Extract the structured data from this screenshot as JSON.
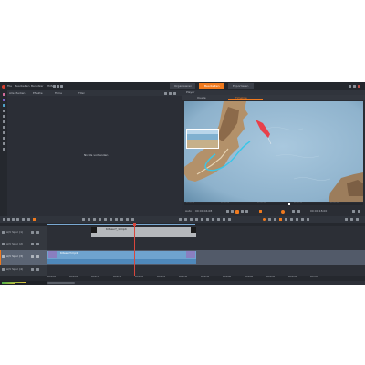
{
  "app": {
    "menu": [
      "File",
      "Bearbeiten",
      "Benutzer",
      "Hilfe"
    ],
    "mode_tabs": [
      {
        "label": "Organisieren",
        "active": false
      },
      {
        "label": "Bearbeiten",
        "active": true
      },
      {
        "label": "Exportieren",
        "active": false
      }
    ]
  },
  "library": {
    "toolbar": [
      "Alle Medien",
      "Effekte",
      "Filme",
      "Titel"
    ],
    "empty_text": "Nichts vorhanden"
  },
  "player": {
    "title": "Player",
    "tabs": [
      "Quelle",
      "Timeline"
    ],
    "active_tab": "Timeline",
    "zoom_label": "Auto",
    "timecode_left": "00:00:04.08",
    "timecode_right": "00:00:18.00",
    "ruler_ticks": [
      "00:00:00",
      "00:00:05",
      "00:00:10",
      "00:00:15",
      "00:00:20"
    ]
  },
  "timeline": {
    "tracks": [
      {
        "name": "A/V Spur (1)"
      },
      {
        "name": "A/V Spur (2)"
      },
      {
        "name": "A/V Spur (3)"
      },
      {
        "name": "A/V Spur (4)"
      }
    ],
    "clips": [
      {
        "label": "Kitesurf_1.mp4"
      },
      {
        "label": "Kitesurf.mp4"
      }
    ],
    "ruler_ticks": [
      "00:00:00",
      "00:00:05",
      "00:00:10",
      "00:00:15",
      "00:00:20",
      "00:00:25",
      "00:00:30",
      "00:00:35",
      "00:00:40",
      "00:00:45",
      "00:00:50",
      "00:00:55",
      "00:01:00"
    ],
    "playhead_position_fraction": 0.27,
    "meter_levels": [
      0.6,
      0.3
    ]
  },
  "colors": {
    "accent_orange": "#f07a1e",
    "panel_bg": "#2b2e36",
    "track_selected": "#525a69",
    "clip_blue": "#6fa3cf",
    "clip_gray": "#b5b8bc",
    "playhead_red": "#d8463c",
    "map_sea": "#8eb2cc"
  }
}
